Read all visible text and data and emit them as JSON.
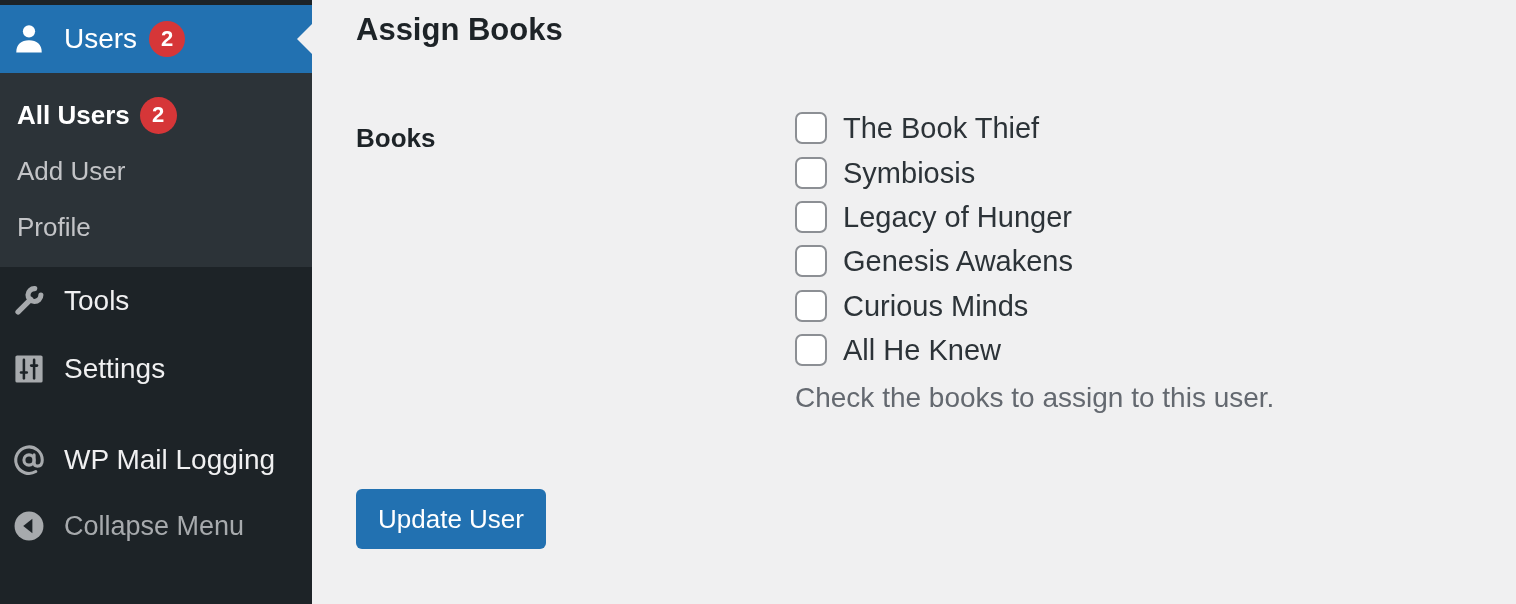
{
  "sidebar": {
    "menu_groups": [
      [
        {
          "label": "Users",
          "badge": "2",
          "selected": true,
          "children": [
            {
              "label": "All Users",
              "badge": "2",
              "selected": true
            },
            {
              "label": "Add User",
              "selected": false
            },
            {
              "label": "Profile",
              "selected": false
            }
          ]
        },
        {
          "label": "Tools",
          "selected": false
        },
        {
          "label": "Settings",
          "selected": false
        }
      ],
      [
        {
          "label": "WP Mail Logging",
          "selected": false
        }
      ]
    ],
    "collapse": {
      "label": "Collapse Menu"
    }
  },
  "page": {
    "heading": "Assign Books"
  },
  "books": {
    "label": "Books",
    "options": [
      {
        "label": "The Book Thief",
        "checked": false
      },
      {
        "label": "Symbiosis",
        "checked": false
      },
      {
        "label": "Legacy of Hunger",
        "checked": false
      },
      {
        "label": "Genesis Awakens",
        "checked": false
      },
      {
        "label": "Curious Minds",
        "checked": false
      },
      {
        "label": "All He Knew",
        "checked": false
      }
    ],
    "description": "Check the books to assign to this user."
  },
  "submit": {
    "label": "Update User"
  }
}
